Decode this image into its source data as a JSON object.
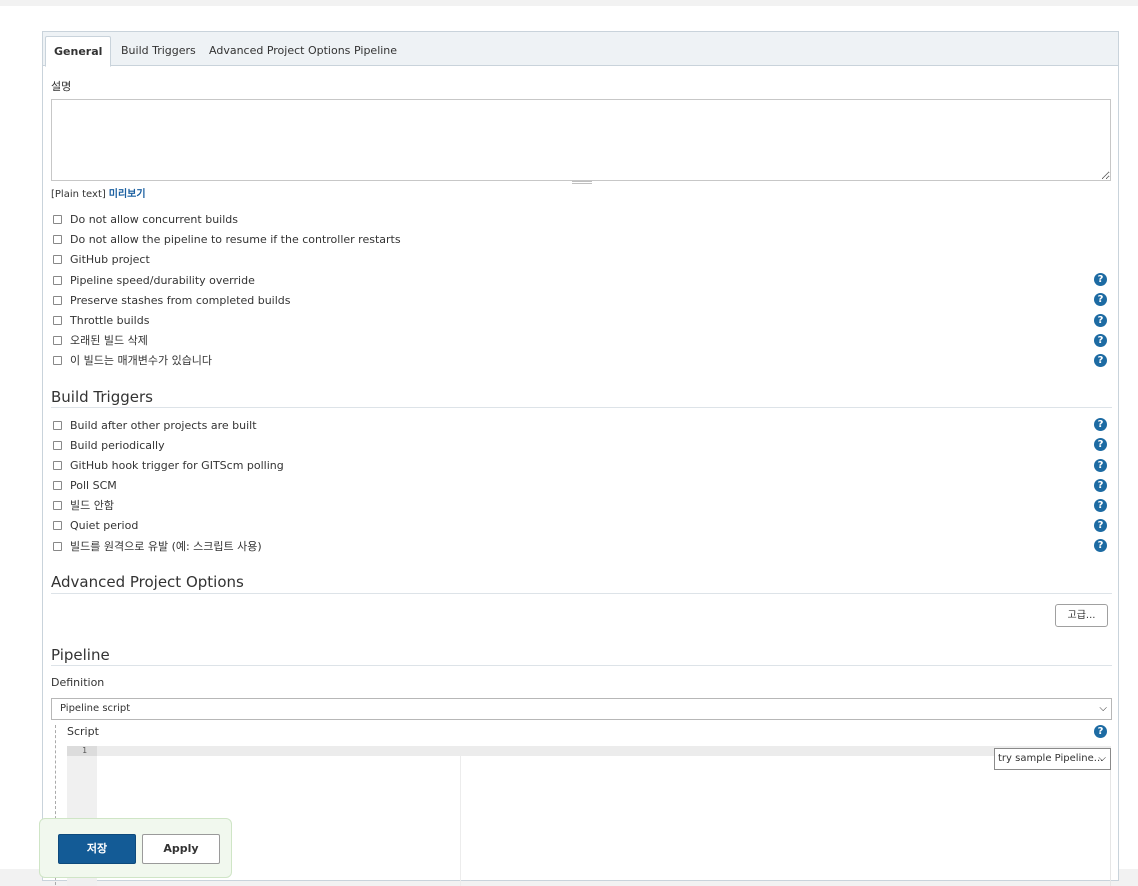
{
  "tabs": [
    {
      "label": "General",
      "active": true
    },
    {
      "label": "Build Triggers",
      "active": false
    },
    {
      "label": "Advanced Project Options",
      "active": false
    },
    {
      "label": "Pipeline",
      "active": false
    }
  ],
  "general": {
    "description_label": "설명",
    "description_value": "",
    "plain_text_label": "[Plain text]",
    "preview_link": "미리보기",
    "options": [
      {
        "label": "Do not allow concurrent builds",
        "checked": false,
        "help": false
      },
      {
        "label": "Do not allow the pipeline to resume if the controller restarts",
        "checked": false,
        "help": false
      },
      {
        "label": "GitHub project",
        "checked": false,
        "help": false
      },
      {
        "label": "Pipeline speed/durability override",
        "checked": false,
        "help": true
      },
      {
        "label": "Preserve stashes from completed builds",
        "checked": false,
        "help": true
      },
      {
        "label": "Throttle builds",
        "checked": false,
        "help": true
      },
      {
        "label": "오래된 빌드 삭제",
        "checked": false,
        "help": true
      },
      {
        "label": "이 빌드는 매개변수가 있습니다",
        "checked": false,
        "help": true
      }
    ]
  },
  "build_triggers": {
    "title": "Build Triggers",
    "options": [
      {
        "label": "Build after other projects are built",
        "checked": false,
        "help": true
      },
      {
        "label": "Build periodically",
        "checked": false,
        "help": true
      },
      {
        "label": "GitHub hook trigger for GITScm polling",
        "checked": false,
        "help": true
      },
      {
        "label": "Poll SCM",
        "checked": false,
        "help": true
      },
      {
        "label": "빌드 안함",
        "checked": false,
        "help": true
      },
      {
        "label": "Quiet period",
        "checked": false,
        "help": true
      },
      {
        "label": "빌드를 원격으로 유발 (예: 스크립트 사용)",
        "checked": false,
        "help": true
      }
    ]
  },
  "advanced": {
    "title": "Advanced Project Options",
    "button_label": "고급..."
  },
  "pipeline": {
    "title": "Pipeline",
    "definition_label": "Definition",
    "definition_value": "Pipeline script",
    "script_label": "Script",
    "line_number": "1",
    "sample_select": "try sample Pipeline..."
  },
  "footer": {
    "save_label": "저장",
    "apply_label": "Apply"
  },
  "colors": {
    "accent": "#135b96",
    "help": "#1d6ba3",
    "link": "#1a5fa0"
  },
  "icons": {
    "help": "help-icon",
    "chevron": "chevron-down-icon",
    "checkbox": "checkbox-icon"
  }
}
